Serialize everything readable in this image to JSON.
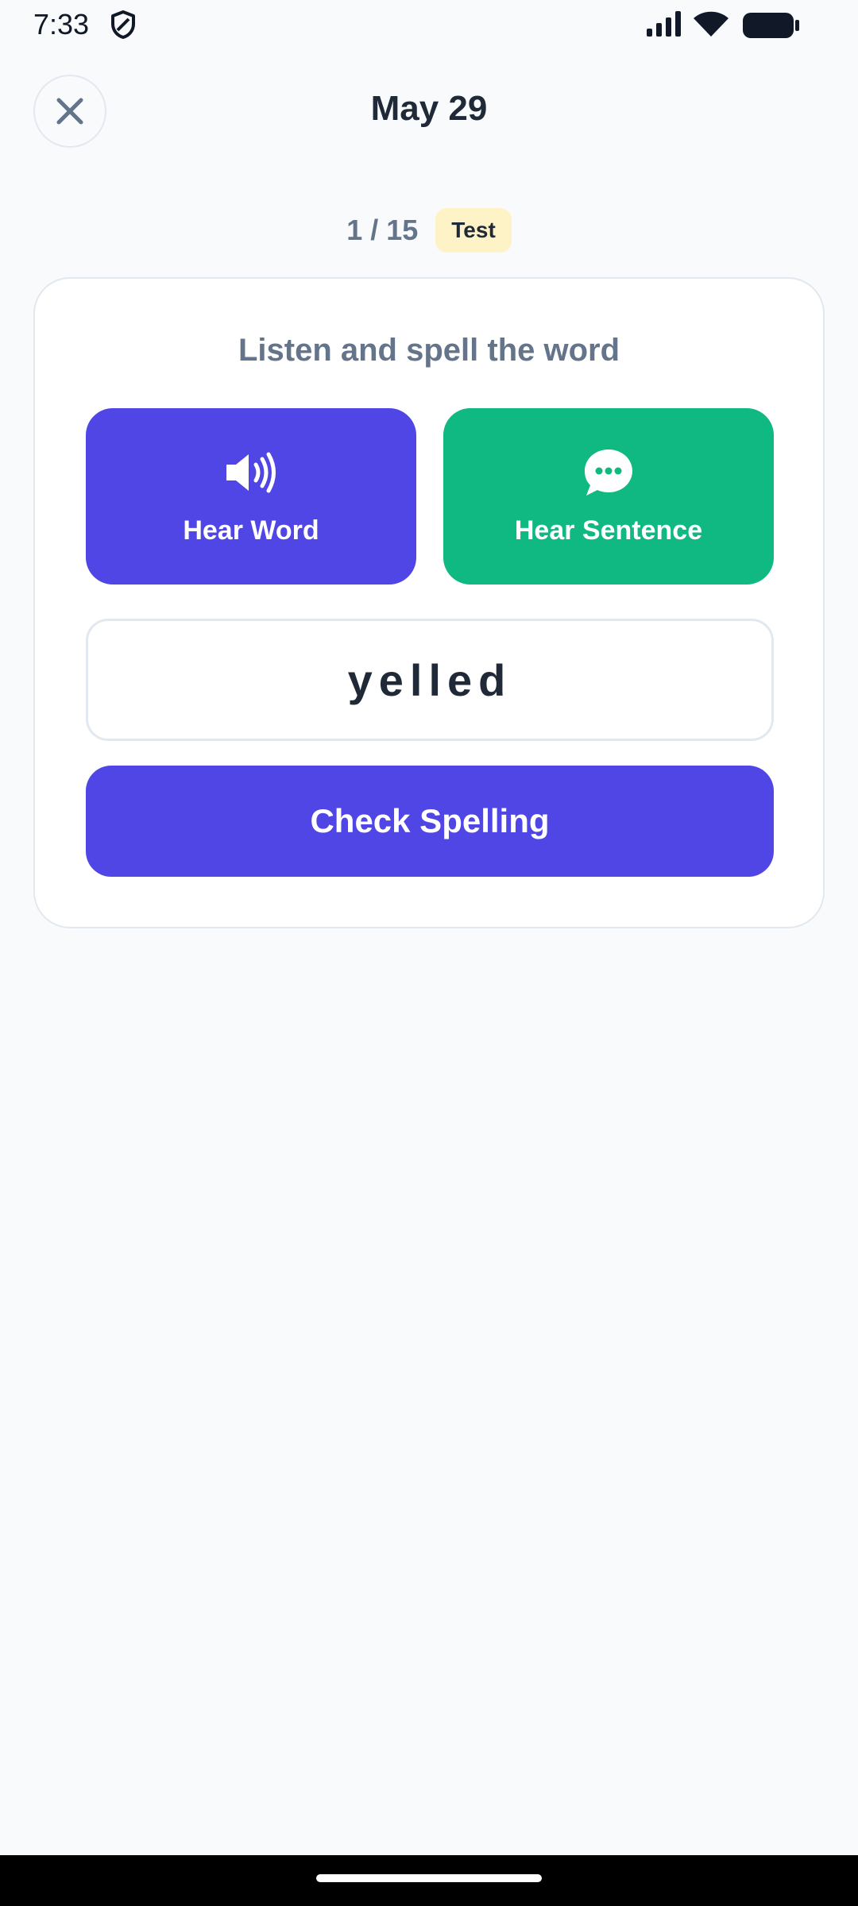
{
  "status_bar": {
    "time": "7:33",
    "icons": [
      "shield-icon",
      "signal-icon",
      "wifi-icon",
      "battery-icon"
    ]
  },
  "header": {
    "title": "May 29",
    "close_icon": "close-icon"
  },
  "progress": {
    "count": "1 / 15",
    "mode": "Test"
  },
  "card": {
    "instruction": "Listen and spell the word",
    "hear_word": {
      "label": "Hear Word",
      "icon": "speaker-icon"
    },
    "hear_sentence": {
      "label": "Hear Sentence",
      "icon": "chat-bubble-icon"
    },
    "input_value": "yelled",
    "check_label": "Check Spelling"
  },
  "colors": {
    "primary": "#4f46e5",
    "secondary": "#10b981",
    "badge_bg": "#fef3c7",
    "background": "#f8fafc"
  }
}
